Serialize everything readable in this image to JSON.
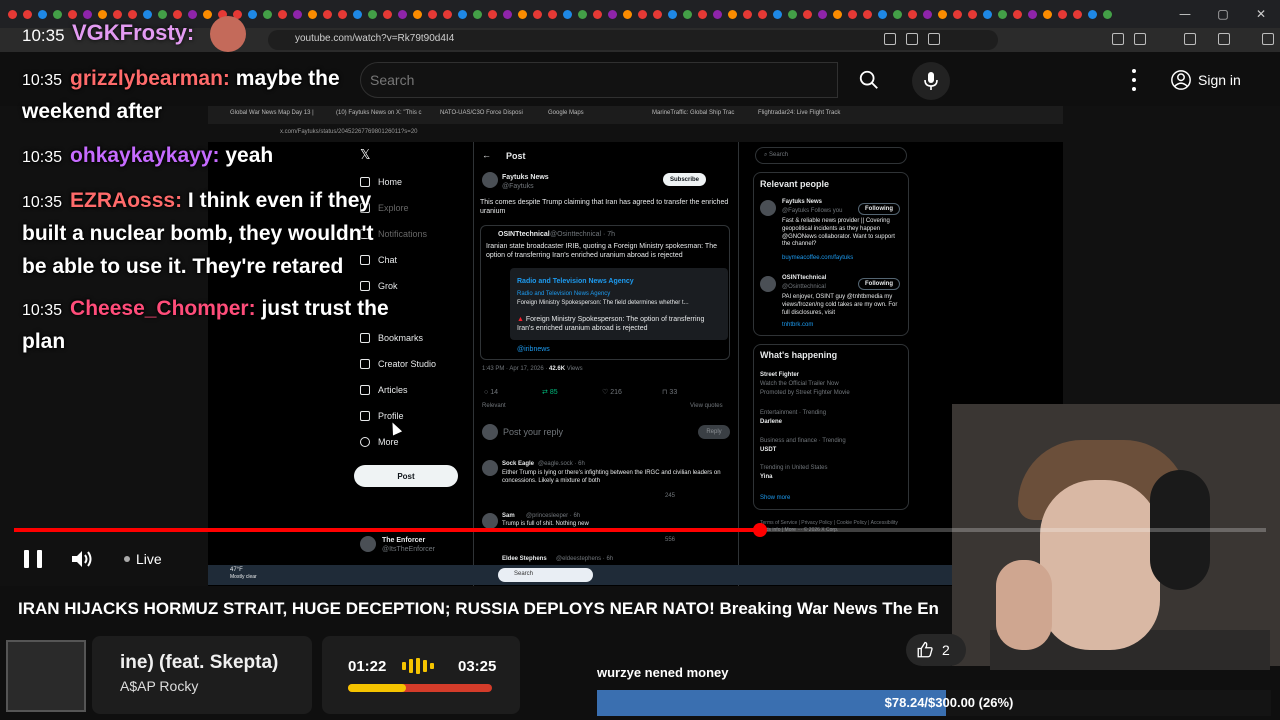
{
  "browser": {
    "url": "youtube.com/watch?v=Rk79t90d4I4",
    "window_controls": [
      "—",
      "▢",
      "✕"
    ]
  },
  "youtube": {
    "search_placeholder": "Search",
    "signin_label": "Sign in"
  },
  "chat": {
    "top_user": "VGKFrosty:",
    "top_time": "10:35",
    "messages": [
      {
        "time": "10:35",
        "user": "grizzlybearman:",
        "text": "maybe the",
        "cont": "weekend after"
      },
      {
        "time": "10:35",
        "user": "ohkaykaykayy:",
        "text": "yeah"
      },
      {
        "time": "10:35",
        "user": "EZRAosss:",
        "text": "I think even if they",
        "cont1": "built a nuclear bomb, they wouldn't",
        "cont2": "be able to use it. They're retared"
      },
      {
        "time": "10:35",
        "user": "Cheese_Chomper:",
        "text": "just trust the",
        "cont": "plan"
      }
    ]
  },
  "inner_browser": {
    "tabs": [
      "Global War News Map Day 13 |",
      "(10) Faytuks News on X: \"This c",
      "NATO-UAS/C3O Force Disposi",
      "Google Maps",
      "MarineTraffic: Global Ship Trac",
      "Flightradar24: Live Flight Track"
    ],
    "url": "x.com/Faytuks/status/2045226776980126011?s=20"
  },
  "x_sidebar": {
    "items": [
      "Home",
      "Explore",
      "Notifications",
      "Chat",
      "Grok",
      "Bookmarks",
      "Creator Studio",
      "Articles",
      "Profile",
      "More"
    ],
    "post_button": "Post",
    "account_name": "The Enforcer",
    "account_handle": "@ItsTheEnforcer"
  },
  "x_post": {
    "header": "Post",
    "author": "Faytuks News",
    "handle": "@Faytuks",
    "subscribe": "Subscribe",
    "text": "This comes despite Trump claiming that Iran has agreed to transfer the enriched uranium",
    "quote_author": "OSINTtechnical",
    "quote_handle": "@Osinttechnical · 7h",
    "quote_text": "Iranian state broadcaster IRIB, quoting a Foreign Ministry spokesman: The option of transferring Iran's enriched uranium abroad is rejected",
    "tg_channel": "Radio and Television News Agency",
    "tg_sub": "Radio and Television News Agency",
    "tg_sub2": "Foreign Ministry Spokesperson: The field determines whether t...",
    "tg_body": "Foreign Ministry Spokesperson: The option of transferring Iran's enriched uranium abroad is rejected",
    "tg_link": "@irib­news",
    "meta": "1:43 PM · Apr 17, 2026 · ",
    "views": "42.6K",
    "views_label": " Views",
    "stats": {
      "replies": "14",
      "reposts": "85",
      "likes": "216",
      "bookmarks": "33"
    },
    "relevant_label": "Relevant",
    "view_quotes": "View quotes",
    "reply_placeholder": "Post your reply",
    "reply_button": "Reply",
    "replies": [
      {
        "name": "Sock Eagle",
        "handle": "@eagle.sock · 6h",
        "text": "Either Trump is lying or there's infighting between the IRGC and civilian leaders on concessions. Likely a mixture of both",
        "likes": "245"
      },
      {
        "name": "Sam",
        "handle": "@princesleeper · 6h",
        "text": "Trump is full of shit. Nothing new",
        "likes": "556"
      },
      {
        "name": "Eldee Stephens",
        "handle": "@eldeestephens · 6h",
        "text": ""
      }
    ]
  },
  "x_right": {
    "search": "Search",
    "relevant_title": "Relevant people",
    "people": [
      {
        "name": "Faytuks News",
        "handle": "@Faytuks",
        "follows_you": "Follows you",
        "bio": "Fast & reliable news provider || Covering geopolitical incidents as they happen @GNONews collaborator. Want to support the channel?",
        "link": "buymeacoffee.com/faytuks",
        "button": "Following"
      },
      {
        "name": "OSINTtechnical",
        "handle": "@Osinttechnical",
        "bio": "PAI enjoyer, OSINT guy @tnhtbmedia my views/frozen/ng cold takes are my own. For full disclosures, visit",
        "link": "tnhtbrk.com",
        "button": "Following"
      }
    ],
    "happening_title": "What's happening",
    "trends": [
      {
        "title": "Street Fighter",
        "sub": "Watch the Official Trailer Now",
        "promo": "Promoted by Street Fighter Movie"
      },
      {
        "title": "Darlene",
        "sub": "Entertainment · Trending"
      },
      {
        "title": "USDT",
        "sub": "Business and finance · Trending"
      },
      {
        "title": "Yina",
        "sub": "Trending in United States"
      }
    ],
    "show_more": "Show more",
    "footer": "Terms of Service  |  Privacy Policy  |  Cookie Policy  |  Accessibility  |  Ads info  |  More ···  © 2026 X Corp."
  },
  "taskbar": {
    "weather": "47°F",
    "weather_sub": "Mostly clear",
    "search": "Search"
  },
  "player": {
    "live_label": "Live",
    "progress_fraction": 0.596
  },
  "video_title": "IRAN HIJACKS HORMUZ STRAIT, HUGE DECEPTION; RUSSIA DEPLOYS NEAR NATO! Breaking War News The En",
  "like_count": "2",
  "now_playing": {
    "title": "ine) (feat. Skepta)",
    "artist": "A$AP Rocky",
    "current": "01:22",
    "total": "03:25",
    "progress_fraction": 0.4
  },
  "donation": {
    "message": "wurzye nened money",
    "goal_text": "$78.24/$300.00 (26%)",
    "goal_fraction": 0.26
  },
  "colors": {
    "youtube_red": "#ff0000",
    "x_blue": "#1d9bf0",
    "chat_user": "#ff6b6b",
    "eq_yellow": "#f5c400",
    "goal_blue": "#3a6fb0"
  }
}
